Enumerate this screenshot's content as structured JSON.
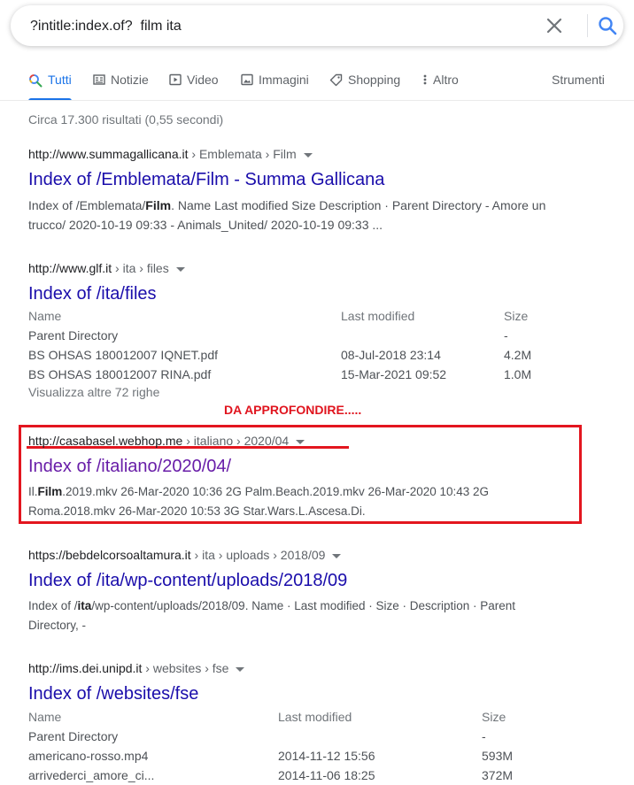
{
  "search": {
    "query": "?intitle:index.of?  film ita"
  },
  "tabs": [
    {
      "label": "Tutti",
      "icon": "search-icon"
    },
    {
      "label": "Notizie",
      "icon": "news-icon"
    },
    {
      "label": "Video",
      "icon": "video-icon"
    },
    {
      "label": "Immagini",
      "icon": "image-icon"
    },
    {
      "label": "Shopping",
      "icon": "tag-icon"
    },
    {
      "label": "Altro",
      "icon": "more-vert-icon"
    }
  ],
  "tools_label": "Strumenti",
  "stats": "Circa 17.300 risultati (0,55 secondi)",
  "accent_color": "#1a73e8",
  "annotation": {
    "text": "DA APPROFONDIRE.....",
    "color": "#e0141e"
  },
  "results": [
    {
      "host": "http://www.summagallicana.it",
      "path": " › Emblemata › Film",
      "title": "Index of /Emblemata/Film - Summa Gallicana",
      "snippet": {
        "line1_a": "Index of /Emblemata/",
        "line1_b": "Film",
        "line1_c": ". Name Last modified Size Description · Parent Directory - Amore un",
        "line2": "trucco/ 2020-10-19 09:33 - Animals_United/ 2020-10-19 09:33 ..."
      }
    },
    {
      "host": "http://www.glf.it",
      "path": " › ita › files",
      "title": "Index of /ita/files",
      "table": {
        "headers": [
          "Name",
          "Last modified",
          "Size"
        ],
        "rows": [
          [
            "Parent Directory",
            "",
            "-"
          ],
          [
            "BS OHSAS 180012007 IQNET.pdf",
            "08-Jul-2018 23:14",
            "4.2M"
          ],
          [
            "BS OHSAS 180012007 RINA.pdf",
            "15-Mar-2021 09:52",
            "1.0M"
          ]
        ]
      },
      "more": "Visualizza altre 72 righe"
    },
    {
      "host": "http://casabasel.webhop.me",
      "path": " › italiano › 2020/04",
      "title": "Index of /italiano/2020/04/",
      "snippet": {
        "line1_a": "Il.",
        "line1_b": "Film",
        "line1_c": ".2019.mkv 26-Mar-2020 10:36 2G Palm.Beach.2019.mkv 26-Mar-2020 10:43 2G",
        "line2": "Roma.2018.mkv 26-Mar-2020 10:53 3G Star.Wars.L.Ascesa.Di."
      }
    },
    {
      "host": "https://bebdelcorsoaltamura.it",
      "path": " › ita › uploads › 2018/09",
      "title": "Index of /ita/wp-content/uploads/2018/09",
      "snippet": {
        "line1_a": "Index of /",
        "line1_b": "ita",
        "line1_c": "/wp-content/uploads/2018/09. Name · Last modified · Size · Description · Parent",
        "line2": "Directory, -"
      }
    },
    {
      "host": "http://ims.dei.unipd.it",
      "path": " › websites › fse",
      "title": "Index of /websites/fse",
      "table": {
        "headers": [
          "Name",
          "Last modified",
          "Size"
        ],
        "rows": [
          [
            "Parent Directory",
            "",
            "-"
          ],
          [
            "americano-rosso.mp4",
            "2014-11-12 15:56",
            "593M"
          ],
          [
            "arrivederci_amore_ci...",
            "2014-11-06 18:25",
            "372M"
          ]
        ]
      }
    }
  ]
}
